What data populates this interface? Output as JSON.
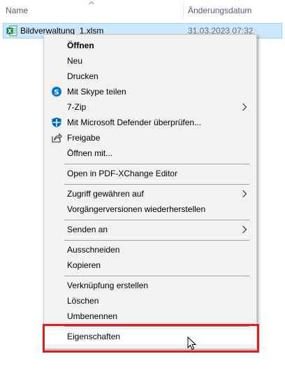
{
  "header": {
    "name_label": "Name",
    "date_label": "Änderungsdatum"
  },
  "file": {
    "name": "Bildverwaltung_1.xlsm",
    "date": "31.03.2023 07:32"
  },
  "menu": {
    "items": [
      {
        "label": "Öffnen"
      },
      {
        "label": "Neu"
      },
      {
        "label": "Drucken"
      },
      {
        "label": "Mit Skype teilen",
        "icon": "skype-icon"
      },
      {
        "label": "7-Zip"
      },
      {
        "label": "Mit Microsoft Defender überprüfen...",
        "icon": "defender-icon"
      },
      {
        "label": "Freigabe",
        "icon": "share-icon"
      },
      {
        "label": "Öffnen mit..."
      },
      {
        "label": "Open in PDF-XChange Editor"
      },
      {
        "label": "Zugriff gewähren auf"
      },
      {
        "label": "Vorgängerversionen wiederherstellen"
      },
      {
        "label": "Senden an"
      },
      {
        "label": "Ausschneiden"
      },
      {
        "label": "Kopieren"
      },
      {
        "label": "Verknüpfung erstellen"
      },
      {
        "label": "Löschen"
      },
      {
        "label": "Umbenennen"
      },
      {
        "label": "Eigenschaften"
      }
    ]
  },
  "colors": {
    "selection": "#cce8ff",
    "menu_bg": "#f2f2f2",
    "highlight_frame": "#e01b24",
    "header_text": "#4c607a"
  }
}
